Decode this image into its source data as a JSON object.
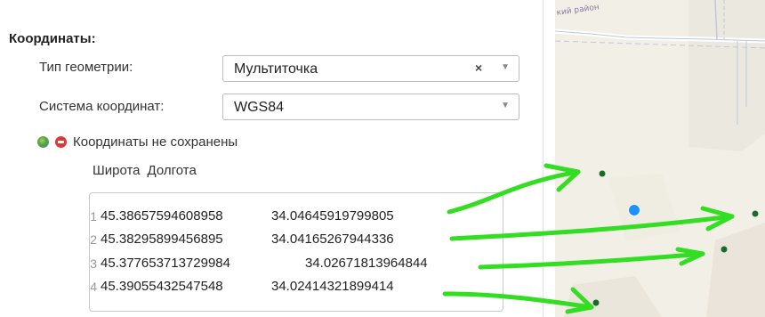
{
  "form": {
    "section_title": "Координаты:",
    "geometry_type": {
      "label": "Тип геометрии:",
      "value": "Мультиточка",
      "clear_glyph": "×",
      "arrow_glyph": "▼"
    },
    "coordinate_system": {
      "label": "Система координат:",
      "value": "WGS84",
      "arrow_glyph": "▼"
    },
    "status": {
      "globe_icon": "globe-icon",
      "stop_icon": "stop-icon",
      "text": "Координаты не сохранены"
    },
    "columns": [
      "Широта",
      "Долгота"
    ]
  },
  "coordinates": [
    {
      "n": "1",
      "lat": "45.38657594608958",
      "lon": "34.04645919799805"
    },
    {
      "n": "2",
      "lat": "45.38295899456895",
      "lon": "34.04165267944336"
    },
    {
      "n": "3",
      "lat": "45.377653713729984",
      "lon": "34.02671813964844"
    },
    {
      "n": "4",
      "lat": "45.39055432547548",
      "lon": "34.02414321899414"
    }
  ],
  "map": {
    "district_label": "кий район",
    "background": "#f1efe6",
    "marker_color": "#1a6b2a",
    "location_color": "#1e90ff",
    "annotation_color": "#33dd22"
  }
}
